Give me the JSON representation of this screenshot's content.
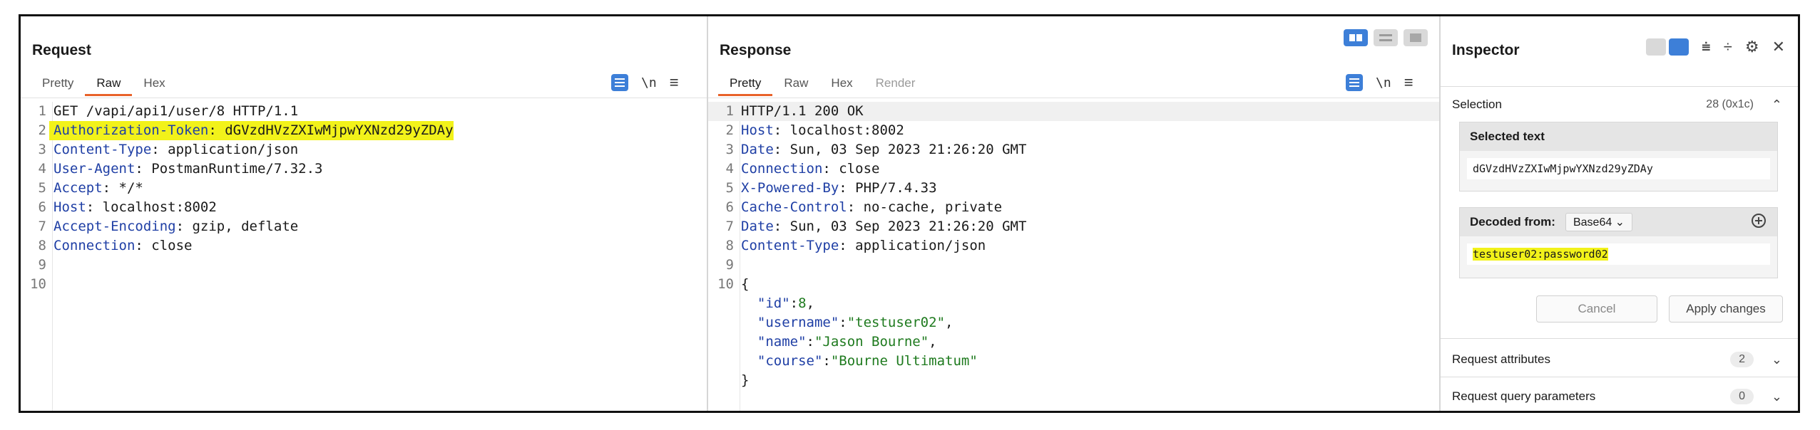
{
  "request": {
    "title": "Request",
    "tabs": [
      "Pretty",
      "Raw",
      "Hex"
    ],
    "active_tab": "Raw",
    "wrap_icon": "wrap-lines-icon",
    "newline_toggle": "\\n",
    "menu_icon": "≡",
    "lines": [
      {
        "n": "1",
        "text": "GET /vapi/api1/user/8 HTTP/1.1"
      },
      {
        "n": "2",
        "key": "Authorization-Token",
        "value": "dGVzdHVzZXIwMjpwYXNzd29yZDAy",
        "highlight": true
      },
      {
        "n": "3",
        "key": "Content-Type",
        "value": "application/json"
      },
      {
        "n": "4",
        "key": "User-Agent",
        "value": "PostmanRuntime/7.32.3"
      },
      {
        "n": "5",
        "key": "Accept",
        "value": "*/*"
      },
      {
        "n": "6",
        "key": "Host",
        "value": "localhost:8002"
      },
      {
        "n": "7",
        "key": "Accept-Encoding",
        "value": "gzip, deflate"
      },
      {
        "n": "8",
        "key": "Connection",
        "value": "close"
      },
      {
        "n": "9",
        "text": ""
      },
      {
        "n": "10",
        "text": ""
      }
    ]
  },
  "response": {
    "title": "Response",
    "tabs": [
      "Pretty",
      "Raw",
      "Hex",
      "Render"
    ],
    "active_tab": "Pretty",
    "newline_toggle": "\\n",
    "menu_icon": "≡",
    "lines": [
      {
        "n": "1",
        "text": "HTTP/1.1 200 OK"
      },
      {
        "n": "2",
        "key": "Host",
        "value": "localhost:8002"
      },
      {
        "n": "3",
        "key": "Date",
        "value": "Sun, 03 Sep 2023 21:26:20 GMT"
      },
      {
        "n": "4",
        "key": "Connection",
        "value": "close"
      },
      {
        "n": "5",
        "key": "X-Powered-By",
        "value": "PHP/7.4.33"
      },
      {
        "n": "6",
        "key": "Cache-Control",
        "value": "no-cache, private"
      },
      {
        "n": "7",
        "key": "Date",
        "value": "Sun, 03 Sep 2023 21:26:20 GMT"
      },
      {
        "n": "8",
        "key": "Content-Type",
        "value": "application/json"
      },
      {
        "n": "9",
        "text": ""
      },
      {
        "n": "10",
        "text": "{"
      }
    ],
    "json_lines": [
      {
        "k": "\"id\"",
        "sep": ":",
        "v": "8",
        "tail": ","
      },
      {
        "k": "\"username\"",
        "sep": ":",
        "v": "\"testuser02\"",
        "tail": ","
      },
      {
        "k": "\"name\"",
        "sep": ":",
        "v": "\"Jason Bourne\"",
        "tail": ","
      },
      {
        "k": "\"course\"",
        "sep": ":",
        "v": "\"Bourne Ultimatum\"",
        "tail": ""
      }
    ],
    "json_close": "}"
  },
  "inspector": {
    "title": "Inspector",
    "selection_label": "Selection",
    "selection_value": "28 (0x1c)",
    "selected_text_label": "Selected text",
    "selected_text": "dGVzdHVzZXIwMjpwYXNzd29yZDAy",
    "decoded_from_label": "Decoded from:",
    "decoded_from_value": "Base64",
    "decoded_text": "testuser02:password02",
    "cancel_label": "Cancel",
    "apply_label": "Apply changes",
    "request_attributes_label": "Request attributes",
    "request_attributes_count": "2",
    "query_params_label": "Request query parameters",
    "query_params_count": "0"
  },
  "colors": {
    "accent_tab": "#e8622a",
    "highlight": "#f2f21a",
    "header_key": "#1f3fa5",
    "json_string": "#1e7a1e",
    "toggle_blue": "#3d7fd8"
  }
}
